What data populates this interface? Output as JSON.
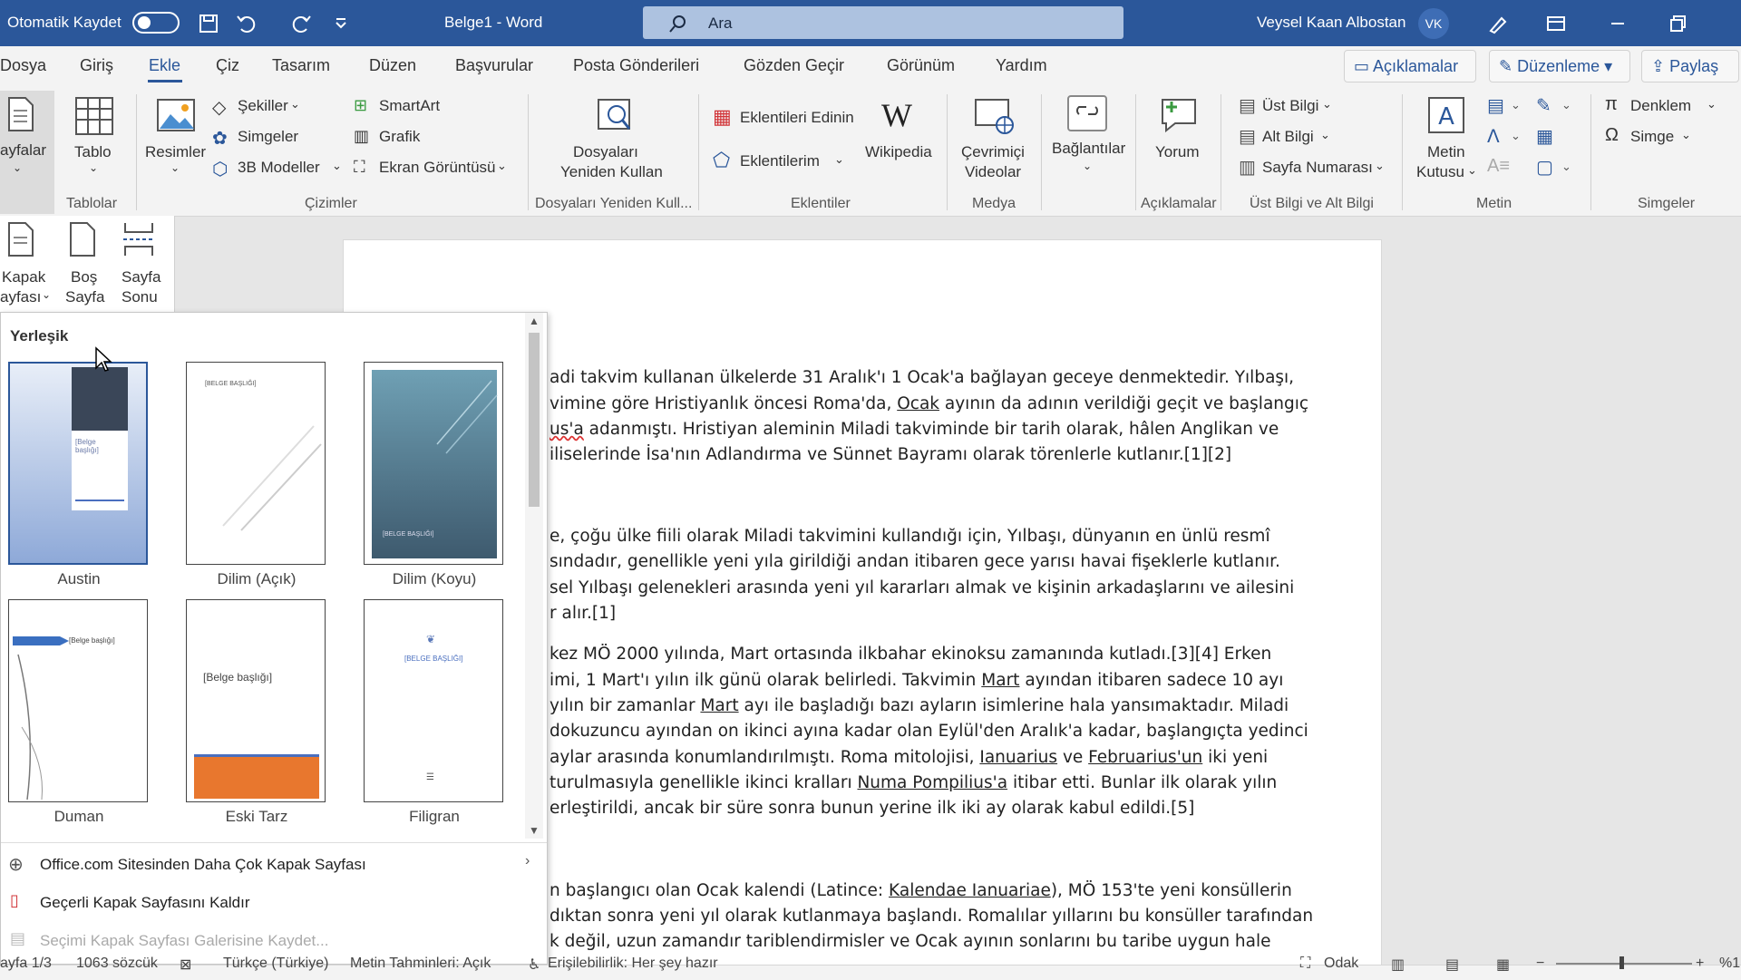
{
  "titlebar": {
    "autosave_label": "Otomatik Kaydet",
    "doc_title": "Belge1  -  Word",
    "search_placeholder": "Ara",
    "user_name": "Veysel Kaan Albostan",
    "user_initials": "VK",
    "bg_color": "#2b579a"
  },
  "tabs": [
    "Dosya",
    "Giriş",
    "Ekle",
    "Çiz",
    "Tasarım",
    "Düzen",
    "Başvurular",
    "Posta Gönderileri",
    "Gözden Geçir",
    "Görünüm",
    "Yardım"
  ],
  "active_tab": "Ekle",
  "right_buttons": {
    "comments": "Açıklamalar",
    "editing": "Düzenleme",
    "share": "Paylaş"
  },
  "ribbon": {
    "pages_label_1": "ayfalar",
    "table_label": "Tablo",
    "pictures_label": "Resimler",
    "shapes": "Şekiller",
    "icons": "Simgeler",
    "models3d": "3B Modeller",
    "smartart": "SmartArt",
    "chart": "Grafik",
    "screenshot": "Ekran Görüntüsü",
    "reuse_1": "Dosyaları",
    "reuse_2": "Yeniden Kullan",
    "get_addins": "Eklentileri Edinin",
    "my_addins": "Eklentilerim",
    "wikipedia": "Wikipedia",
    "online_video_1": "Çevrimiçi",
    "online_video_2": "Videolar",
    "links": "Bağlantılar",
    "comment": "Yorum",
    "header": "Üst Bilgi",
    "footer": "Alt Bilgi",
    "page_number": "Sayfa Numarası",
    "textbox_1": "Metin",
    "textbox_2": "Kutusu",
    "equation": "Denklem",
    "symbol": "Simge",
    "groups": {
      "tables": "Tablolar",
      "illustrations": "Çizimler",
      "reuse": "Dosyaları Yeniden Kull...",
      "addins": "Eklentiler",
      "media": "Medya",
      "comments": "Açıklamalar",
      "header_footer": "Üst Bilgi ve Alt Bilgi",
      "text": "Metin",
      "symbols": "Simgeler"
    }
  },
  "pages_dropdown": {
    "cover_1": "Kapak",
    "cover_2": "ayfası",
    "blank_1": "Boş",
    "blank_2": "Sayfa",
    "break_1": "Sayfa",
    "break_2": "Sonu"
  },
  "gallery": {
    "section_title": "Yerleşik",
    "templates": [
      "Austin",
      "Dilim (Açık)",
      "Dilim (Koyu)",
      "Duman",
      "Eski Tarz",
      "Filigran"
    ],
    "thumb_text": {
      "austin_title": "[Belge başlığı]",
      "slice_light_title": "[BELGE BAŞLIĞI]",
      "slice_dark_title": "[BELGE BAŞLIĞI]",
      "smoke_title": "[Belge başlığı]",
      "retro_title": "[Belge başlığı]",
      "filigree_title": "[BELGE BAŞLIĞI]"
    },
    "menu": [
      "Office.com Sitesinden Daha Çok Kapak Sayfası",
      "Geçerli Kapak Sayfasını Kaldır",
      "Seçimi Kapak Sayfası Galerisine Kaydet..."
    ]
  },
  "document": {
    "lines": [
      "adi takvim kullanan ülkelerde 31 Aralık'ı 1 Ocak'a bağlayan geceye denmektedir. Yılbaşı,",
      "vimine göre Hristiyanlık öncesi Roma'da, ",
      "us'a adanmıştı. Hristiyan aleminin Miladi takviminde bir tarih olarak, hâlen Anglikan ve",
      "iliselerinde İsa'nın Adlandırma ve Sünnet Bayramı olarak törenlerle kutlanır.[1][2]",
      "e, çoğu ülke fiili olarak Miladi takvimini kullandığı için, Yılbaşı, dünyanın en ünlü resmî",
      "sındadır, genellikle yeni yıla girildiği andan itibaren gece yarısı havai fişeklerle kutlanır.",
      "sel Yılbaşı gelenekleri arasında yeni yıl kararları almak ve kişinin arkadaşlarını ve ailesini",
      "r alır.[1]",
      "kez MÖ 2000 yılında, Mart ortasında ilkbahar ekinoksu zamanında kutladı.[3][4] Erken",
      "imi, 1 Mart'ı yılın ilk günü olarak belirledi. Takvimin ",
      "yılın bir zamanlar ",
      "dokuzuncu ayından on ikinci ayına kadar olan Eylül'den Aralık'a kadar, başlangıçta yedinci",
      "aylar arasında konumlandırılmıştı. Roma mitolojisi, ",
      "turulmasıyla genellikle ikinci kralları ",
      "erleştirildi, ancak bir süre sonra bunun yerine ilk iki ay olarak kabul edildi.[5]",
      "n başlangıcı olan Ocak kalendi (Latince: ",
      "dıktan sonra yeni yıl olarak kutlanmaya başlandı. Romalılar yıllarını bu konsüller tarafından",
      "k değil, uzun zamandır tariblendirmisler ve Ocak ayının sonlarını bu taribe uygun hale"
    ],
    "line1_link": "Ocak",
    "line1_rest": " ayının da adının verildiği geçit ve başlangıç",
    "line2_squiggle": "us'a",
    "line9_link": "Mart",
    "line9_rest": " ayından itibaren sadece 10 ayı",
    "line10_link": "Mart",
    "line10_rest": " ayı ile başladığı bazı ayların isimlerine hala yansımaktadır. Miladi",
    "line12_link1": "Ianuarius",
    "line12_mid": " ve ",
    "line12_link2": "Februarius'un",
    "line12_rest": " iki yeni",
    "line13_link": "Numa Pompilius'a",
    "line13_rest": " itibar etti. Bunlar ilk olarak yılın",
    "line15_link": "Kalendae Ianuariae",
    "line15_rest": "), MÖ 153'te yeni konsüllerin"
  },
  "statusbar": {
    "page": "ayfa 1/3",
    "words": "1063 sözcük",
    "language": "Türkçe (Türkiye)",
    "predictions": "Metin Tahminleri: Açık",
    "accessibility": "Erişilebilirlik: Her şey hazır",
    "focus": "Odak",
    "zoom": "%1"
  }
}
